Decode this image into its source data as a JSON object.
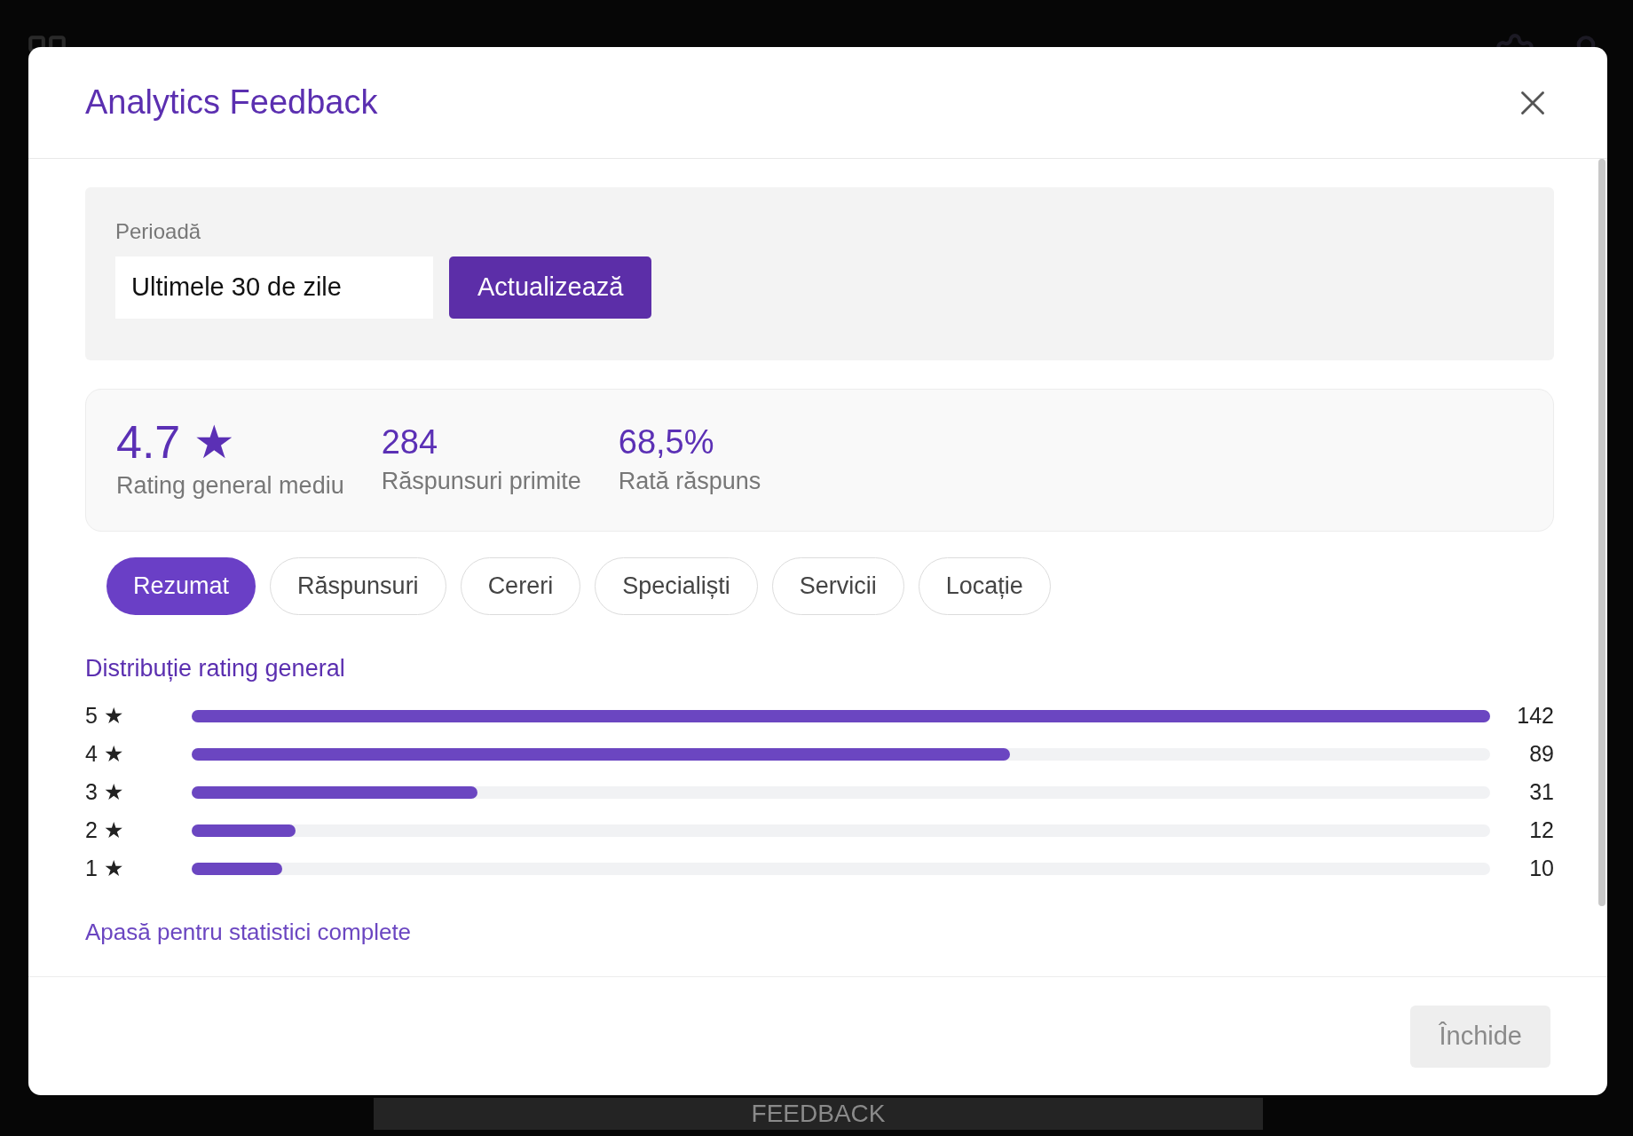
{
  "background": {
    "footer_label": "FEEDBACK"
  },
  "dialog": {
    "title": "Analytics Feedback",
    "period": {
      "label": "Perioadă",
      "value": "Ultimele 30 de zile",
      "button": "Actualizează"
    },
    "stats": [
      {
        "value": "4.7 ★",
        "label": "Rating general mediu",
        "kind": "rating"
      },
      {
        "value": "284",
        "label": "Răspunsuri primite",
        "kind": "number"
      },
      {
        "value": "68,5%",
        "label": "Rată răspuns",
        "kind": "number"
      }
    ],
    "tabs": [
      {
        "label": "Rezumat",
        "selected": true
      },
      {
        "label": "Răspunsuri",
        "selected": false
      },
      {
        "label": "Cereri",
        "selected": false
      },
      {
        "label": "Specialiști",
        "selected": false
      },
      {
        "label": "Servicii",
        "selected": false
      },
      {
        "label": "Locație",
        "selected": false
      }
    ],
    "distribution": {
      "title": "Distribuție rating general",
      "rows": [
        {
          "label": "5 ★",
          "level": 1,
          "count": "142"
        },
        {
          "label": "4 ★",
          "level": 0.63,
          "count": "89"
        },
        {
          "label": "3 ★",
          "level": 0.22,
          "count": "31"
        },
        {
          "label": "2 ★",
          "level": 0.08,
          "count": "12"
        },
        {
          "label": "1 ★",
          "level": 0.07,
          "count": "10"
        }
      ]
    },
    "link": "Apasă pentru statistici complete",
    "close_button": {
      "label": "Închide",
      "disabled": true
    }
  }
}
